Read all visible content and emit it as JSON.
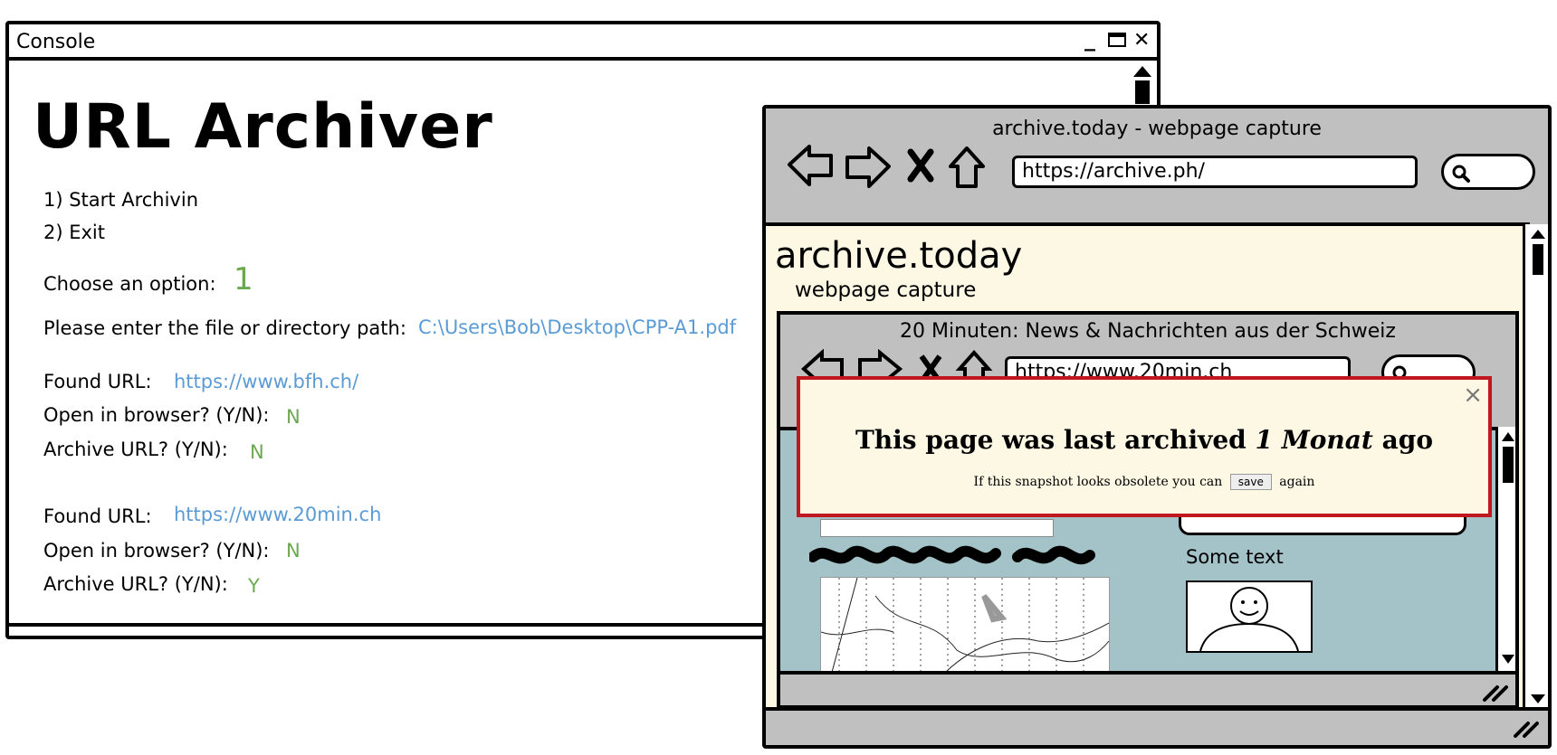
{
  "console": {
    "window_title": "Console",
    "controls": {
      "minimize": "_",
      "close": "✕"
    },
    "app_title": "URL Archiver",
    "menu": [
      "1) Start Archivin",
      "2) Exit"
    ],
    "choose_label": "Choose an option:",
    "choose_value": "1",
    "path_label": "Please enter the file or directory path:",
    "path_value": "C:\\Users\\Bob\\Desktop\\CPP-A1.pdf",
    "entries": [
      {
        "found_label": "Found URL:",
        "url": "https://www.bfh.ch/",
        "open_label": "Open in browser? (Y/N):",
        "open_value": "N",
        "archive_label": "Archive URL? (Y/N):",
        "archive_value": "N"
      },
      {
        "found_label": "Found URL:",
        "url": "https://www.20min.ch",
        "open_label": "Open in browser? (Y/N):",
        "open_value": "N",
        "archive_label": "Archive URL? (Y/N):",
        "archive_value": "Y"
      }
    ]
  },
  "browser": {
    "title": "archive.today - webpage capture",
    "url": "https://archive.ph/",
    "site_title": "archive.today",
    "site_subtitle": "webpage capture",
    "inner": {
      "title": "20 Minuten: News & Nachrichten aus der Schweiz",
      "url": "https://www.20min.ch",
      "some_text": "Some text"
    }
  },
  "popup": {
    "heading_pre": "This page was last archived",
    "heading_time": "1 Monat",
    "heading_post": "ago",
    "note_pre": "If this snapshot looks obsolete you can",
    "save_label": "save",
    "note_post": "again",
    "close": "×"
  }
}
